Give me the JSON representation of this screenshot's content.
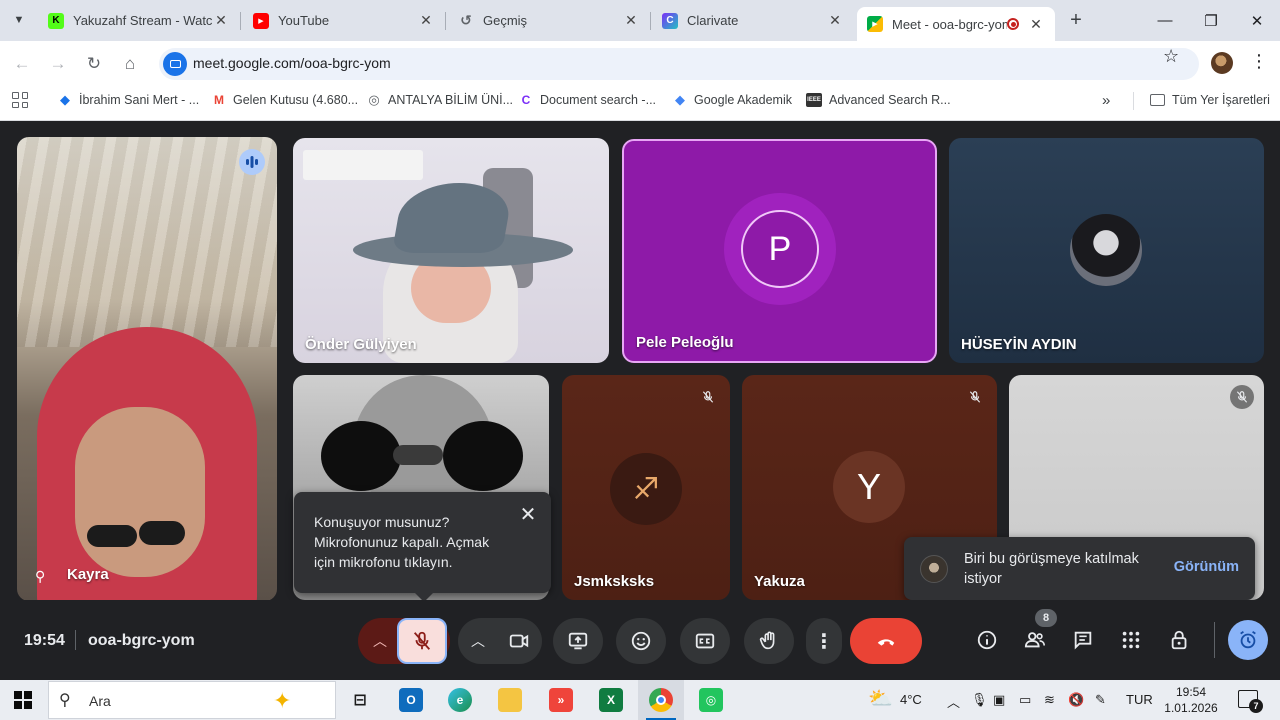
{
  "browser": {
    "tabs": [
      {
        "title": "Yakuzahf Stream - Watch",
        "favicon_color": "#53fc18",
        "favicon_text": "K"
      },
      {
        "title": "YouTube",
        "favicon_color": "#ff0000",
        "favicon_text": "▶"
      },
      {
        "title": "Geçmiş",
        "favicon_color": "#5f6368",
        "favicon_text": "↺"
      },
      {
        "title": "Clarivate",
        "favicon_color": "#7b2ff7",
        "favicon_text": "C"
      },
      {
        "title": "Meet - ooa-bgrc-yom",
        "favicon_color": "#00897b",
        "favicon_text": "▶"
      }
    ],
    "url": "meet.google.com/ooa-bgrc-yom",
    "bookmarks": [
      {
        "label": "İbrahim Sani Mert - ...",
        "color": "#1a73e8",
        "icon": "◆"
      },
      {
        "label": "Gelen Kutusu (4.680...",
        "color": "#ea4335",
        "icon": "M"
      },
      {
        "label": "ANTALYA BİLİM ÜNİ...",
        "color": "#5f6368",
        "icon": "◎"
      },
      {
        "label": "Document search -...",
        "color": "#7b2ff7",
        "icon": "C"
      },
      {
        "label": "Google Akademik",
        "color": "#4285f4",
        "icon": "◆"
      },
      {
        "label": "Advanced Search R...",
        "color": "#333333",
        "icon": "IEEE"
      }
    ],
    "all_bookmarks": "Tüm Yer İşaretleri"
  },
  "meet": {
    "participants": {
      "kayra": "Kayra",
      "onder": "Önder Gülyiyen",
      "pele": "Pele Peleoğlu",
      "pele_initial": "P",
      "huseyin": "HÜSEYİN AYDIN",
      "jsmk": "Jsmksksks",
      "yakuza": "Yakuza",
      "yakuza_initial": "Y"
    },
    "mic_popup": "Konuşuyor musunuz? Mikrofonunuz kapalı. Açmak için mikrofonu tıklayın.",
    "join_toast": {
      "text": "Biri bu görüşmeye katılmak istiyor",
      "button": "Görünüm"
    },
    "time": "19:54",
    "meeting_code": "ooa-bgrc-yom",
    "people_count": "8",
    "colors": {
      "end_call": "#ea4335",
      "mic_off": "#f9dedc",
      "accent": "#8ab4f8",
      "pele_tile": "#8e1aa8"
    }
  },
  "taskbar": {
    "search_placeholder": "Ara",
    "weather": "4°C",
    "language": "TUR",
    "clock_time": "19:54",
    "clock_date": "1.01.2026",
    "notifications": "7"
  }
}
